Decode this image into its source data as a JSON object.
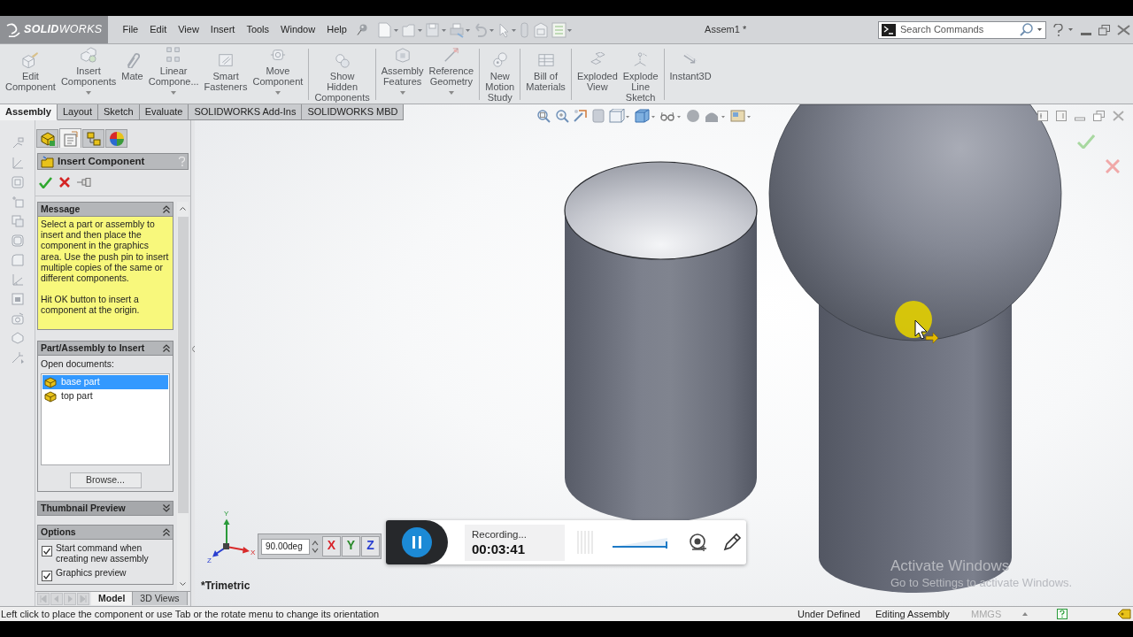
{
  "title_bar": {
    "logo": "**SOLID**WORKS",
    "menu": [
      "File",
      "Edit",
      "View",
      "Insert",
      "Tools",
      "Window",
      "Help"
    ],
    "document_title": "Assem1 *",
    "search": {
      "placeholder": "Search Commands"
    }
  },
  "command_manager": {
    "groups": [
      {
        "buttons": [
          {
            "label": "Edit\nComponent",
            "dropdown": false
          },
          {
            "label": "Insert\nComponents",
            "dropdown": true
          },
          {
            "label": "Mate",
            "dropdown": false
          },
          {
            "label": "Linear\nCompone...",
            "dropdown": true
          },
          {
            "label": "Smart\nFasteners",
            "dropdown": false
          },
          {
            "label": "Move\nComponent",
            "dropdown": true
          }
        ]
      },
      {
        "buttons": [
          {
            "label": "Show\nHidden\nComponents",
            "dropdown": false
          }
        ]
      },
      {
        "buttons": [
          {
            "label": "Assembly\nFeatures",
            "dropdown": true
          },
          {
            "label": "Reference\nGeometry",
            "dropdown": true
          }
        ]
      },
      {
        "buttons": [
          {
            "label": "New\nMotion\nStudy",
            "dropdown": false
          }
        ]
      },
      {
        "buttons": [
          {
            "label": "Bill of\nMaterials",
            "dropdown": false
          }
        ]
      },
      {
        "buttons": [
          {
            "label": "Exploded\nView",
            "dropdown": false
          },
          {
            "label": "Explode\nLine\nSketch",
            "dropdown": false
          }
        ]
      },
      {
        "buttons": [
          {
            "label": "Instant3D",
            "dropdown": false
          }
        ]
      }
    ],
    "tabs": [
      {
        "label": "Assembly",
        "selected": true
      },
      {
        "label": "Layout",
        "selected": false
      },
      {
        "label": "Sketch",
        "selected": false
      },
      {
        "label": "Evaluate",
        "selected": false
      },
      {
        "label": "SOLIDWORKS Add-Ins",
        "selected": false
      },
      {
        "label": "SOLIDWORKS MBD",
        "selected": false
      }
    ]
  },
  "property_manager": {
    "tabs": [
      {
        "selected": false
      },
      {
        "selected": true
      },
      {
        "selected": false
      },
      {
        "selected": false
      }
    ],
    "title": "Insert Component",
    "sections": [
      {
        "kind": "message",
        "title": "Message",
        "expanded": true,
        "paragraphs": [
          "Select a part or assembly to insert and then place the component in the graphics area. Use the push pin to insert multiple copies of the same or different components.",
          "Hit OK button to insert a component at the origin."
        ]
      },
      {
        "kind": "documents",
        "title": "Part/Assembly to Insert",
        "expanded": true,
        "label": "Open documents:",
        "documents": [
          {
            "name": "base part",
            "selected": true
          },
          {
            "name": "top part",
            "selected": false
          }
        ],
        "button": "Browse..."
      },
      {
        "kind": "preview",
        "title": "Thumbnail Preview",
        "expanded": false
      },
      {
        "kind": "options",
        "title": "Options",
        "expanded": true,
        "checkboxes": [
          {
            "label": "Start command when creating new assembly",
            "checked": true
          },
          {
            "label": "Graphics preview",
            "checked": true
          }
        ]
      }
    ]
  },
  "model_tabs": [
    {
      "label": "Model",
      "selected": true
    },
    {
      "label": "3D Views",
      "selected": false
    }
  ],
  "graphics_area": {
    "view_name": "*Trimetric",
    "triad": {
      "x": "X",
      "y": "Y",
      "z": "Z"
    },
    "rotate": {
      "value": "90.00deg",
      "buttons": [
        {
          "label": "X",
          "color": "#d8232a"
        },
        {
          "label": "Y",
          "color": "#2b8a2b"
        },
        {
          "label": "Z",
          "color": "#2a3fd0"
        }
      ]
    }
  },
  "recorder": {
    "status": "Recording...",
    "time": "00:03:41"
  },
  "windows_notice": {
    "title": "Activate Windows",
    "text": "Go to Settings to activate Windows."
  },
  "status_bar": {
    "message": "Left click to place the component or use Tab or the rotate menu to change its orientation",
    "fields": [
      {
        "text": "Under Defined",
        "disabled": false
      },
      {
        "text": "Editing Assembly",
        "disabled": false
      },
      {
        "text": "MMGS",
        "disabled": true
      }
    ]
  }
}
